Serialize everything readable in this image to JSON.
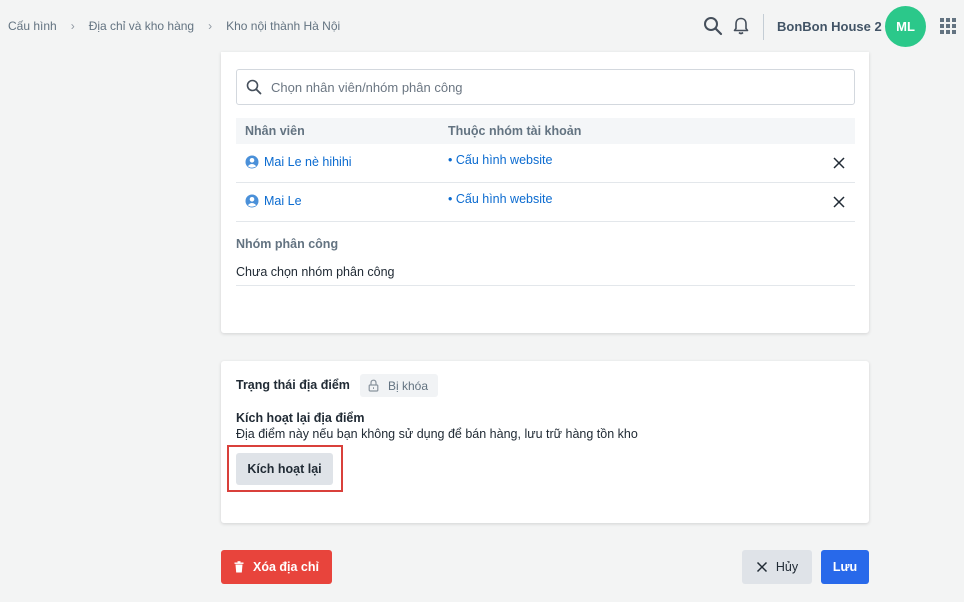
{
  "breadcrumb": [
    "Cấu hình",
    "Địa chỉ và kho hàng",
    "Kho nội thành Hà Nội"
  ],
  "breadcrumb_separator": "›",
  "header": {
    "icons": [
      "search-icon",
      "bell-icon",
      "apps-grid-icon"
    ],
    "shop_name": "BonBon House 2",
    "avatar_initials": "ML",
    "avatar_color": "#2bc88a"
  },
  "staff": {
    "search_placeholder": "Chọn nhân viên/nhóm phân công",
    "columns": [
      "Nhân viên",
      "Thuộc nhóm tài khoản"
    ],
    "rows": [
      {
        "name": "Mai Le nè hihihi",
        "group": "• Cấu hình website"
      },
      {
        "name": "Mai Le",
        "group": "• Cấu hình website"
      }
    ],
    "group_section_label": "Nhóm phân công",
    "group_section_value": "Chưa chọn nhóm phân công"
  },
  "status": {
    "label": "Trạng thái địa điểm",
    "badge": "Bị khóa",
    "reactivate_title": "Kích hoạt lại địa điểm",
    "reactivate_desc": "Địa điểm này nếu bạn không sử dụng để bán hàng, lưu trữ hàng tồn kho",
    "reactivate_button": "Kích hoạt lại",
    "highlight_color": "#d9403b"
  },
  "footer": {
    "delete_label": "Xóa địa chỉ",
    "cancel_label": "Hủy",
    "save_label": "Lưu",
    "delete_color": "#e8443c",
    "save_color": "#2869ea"
  }
}
